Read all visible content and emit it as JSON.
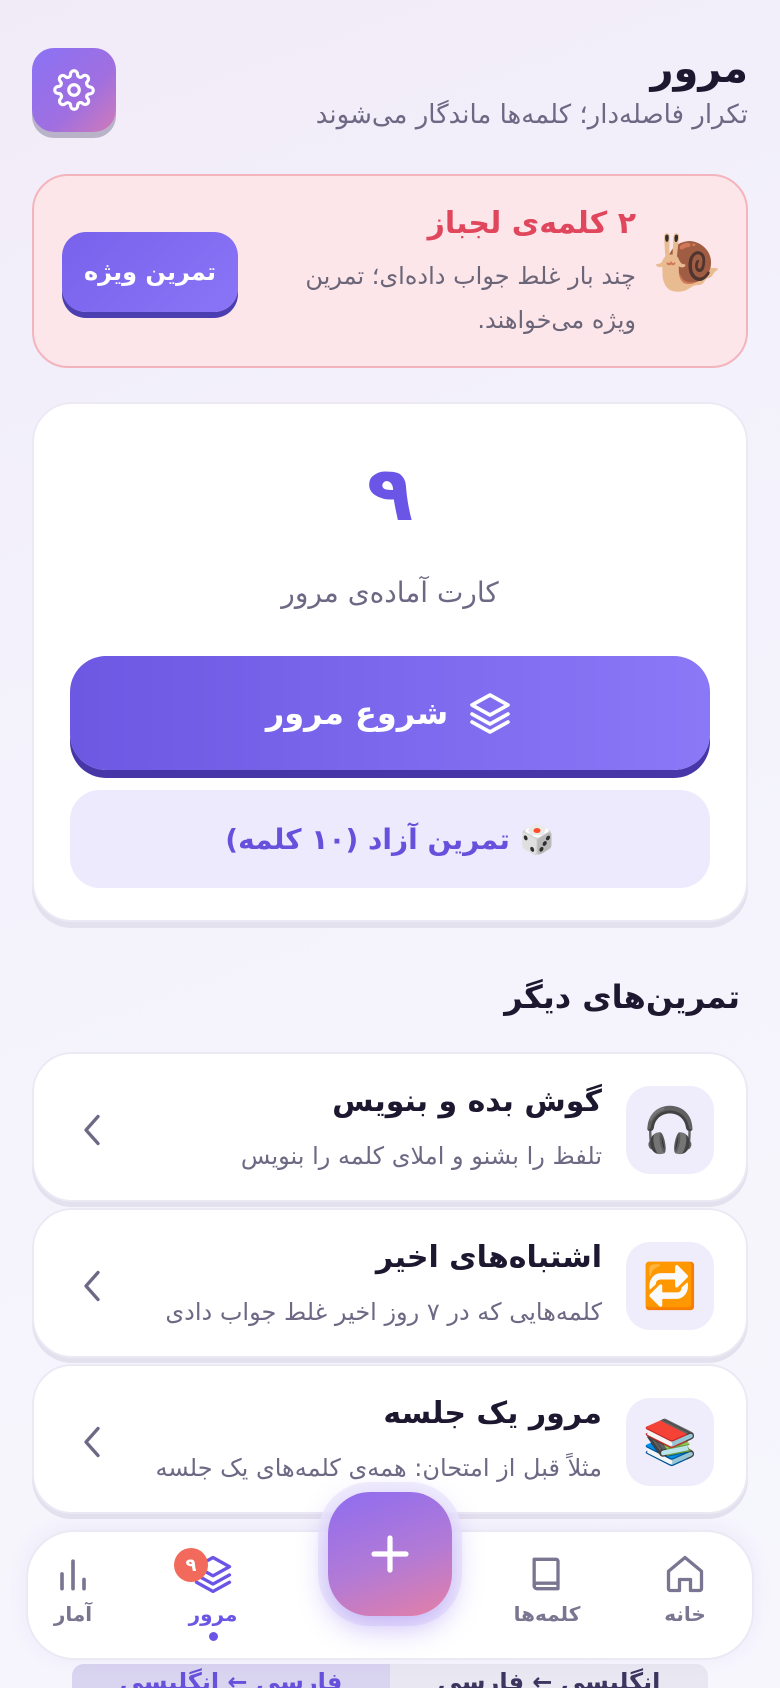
{
  "header": {
    "title": "مرور",
    "subtitle": "تکرار فاصله‌دار؛ کلمه‌ها ماندگار می‌شوند",
    "settings_icon": "gear-icon"
  },
  "stubborn": {
    "icon": "🐌",
    "title": "۲ کلمه‌ی لجباز",
    "description": "چند بار غلط جواب داده‌ای؛ تمرین ویژه می‌خواهند.",
    "button": "تمرین ویژه"
  },
  "review": {
    "count": "۹",
    "count_label": "کارت آماده‌ی مرور",
    "start_button": "شروع مرور",
    "free_practice_icon": "🎲",
    "free_practice_button": "تمرین آزاد (۱۰ کلمه)"
  },
  "other_exercises": {
    "title": "تمرین‌های دیگر",
    "items": [
      {
        "icon": "🎧",
        "title": "گوش بده و بنویس",
        "desc": "تلفظ را بشنو و املای کلمه را بنویس"
      },
      {
        "icon": "🔁",
        "title": "اشتباه‌های اخیر",
        "desc": "کلمه‌هایی که در ۷ روز اخیر غلط جواب دادی"
      },
      {
        "icon": "📚",
        "title": "مرور یک جلسه",
        "desc": "مثلاً قبل از امتحان: همه‌ی کلمه‌های یک جلسه"
      }
    ]
  },
  "nav": {
    "home": "خانه",
    "words": "کلمه‌ها",
    "review": "مرور",
    "review_badge": "۹",
    "stats": "آمار"
  },
  "under_tabs": [
    "انگلیسی ← فارسی",
    "فارسی ← انگلیسی"
  ],
  "colors": {
    "accent": "#6a55e6",
    "danger": "#e0475d",
    "badge": "#f26a5b"
  }
}
